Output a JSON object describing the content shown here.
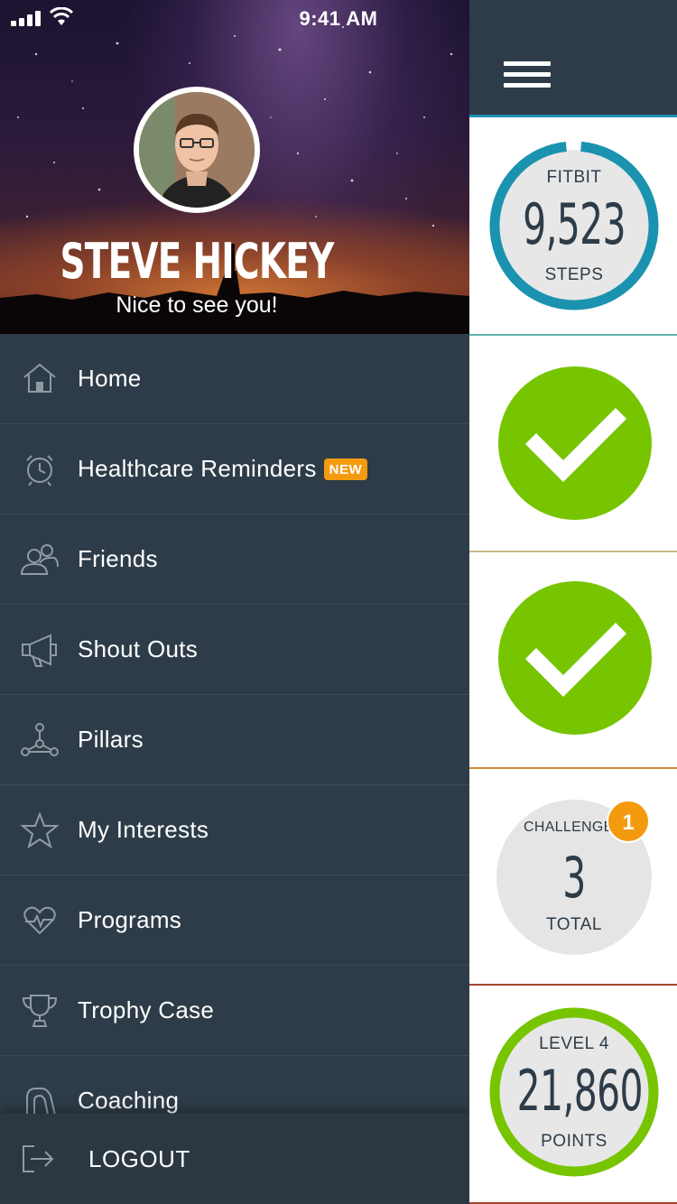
{
  "status_bar": {
    "time": "9:41 AM"
  },
  "profile": {
    "name": "STEVE HICKEY",
    "greeting": "Nice to see you!"
  },
  "menu": {
    "items": [
      {
        "label": "Home",
        "icon": "home-icon"
      },
      {
        "label": "Healthcare Reminders",
        "icon": "alarm-clock-icon",
        "badge": "NEW"
      },
      {
        "label": "Friends",
        "icon": "friends-icon"
      },
      {
        "label": "Shout Outs",
        "icon": "megaphone-icon"
      },
      {
        "label": "Pillars",
        "icon": "pillars-icon"
      },
      {
        "label": "My Interests",
        "icon": "star-icon"
      },
      {
        "label": "Programs",
        "icon": "heart-pulse-icon"
      },
      {
        "label": "Trophy Case",
        "icon": "trophy-icon"
      },
      {
        "label": "Coaching",
        "icon": "coaching-icon"
      }
    ],
    "logout_label": "LOGOUT"
  },
  "dashboard": {
    "steps": {
      "top": "FITBIT",
      "value": "9,523",
      "bottom": "STEPS",
      "ring_progress": 0.97
    },
    "challenges": {
      "top": "CHALLENGES",
      "value": "3",
      "bottom": "TOTAL",
      "badge": "1"
    },
    "points": {
      "top": "LEVEL 4",
      "value": "21,860",
      "bottom": "POINTS"
    }
  },
  "colors": {
    "drawer_bg": "#2d3c48",
    "accent_blue": "#1c8fb0",
    "check_green": "#76c500",
    "badge_orange": "#f39a0f"
  }
}
